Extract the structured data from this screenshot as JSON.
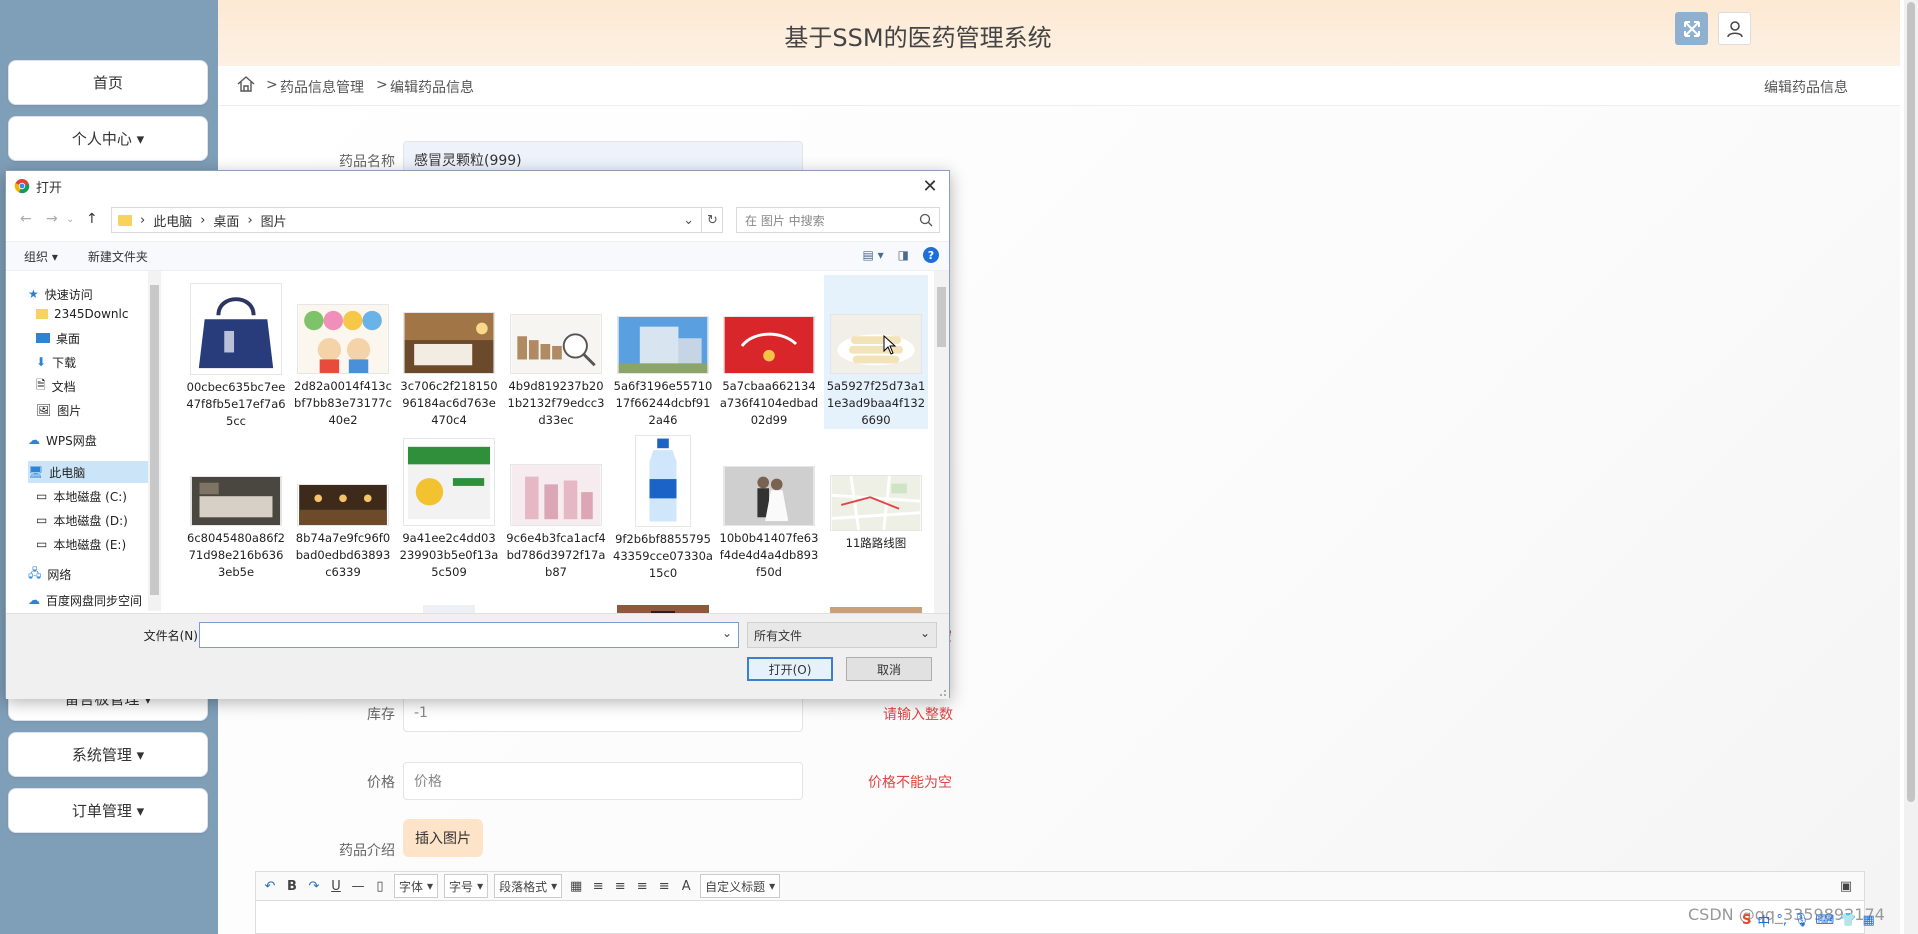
{
  "app": {
    "title": "基于SSM的医药管理系统"
  },
  "sidebar": {
    "items": [
      {
        "label": "首页"
      },
      {
        "label": "个人中心 ▾"
      },
      {
        "label": "留言板管理 ▾"
      },
      {
        "label": "系统管理 ▾"
      },
      {
        "label": "订单管理 ▾"
      }
    ]
  },
  "breadcrumb": {
    "sep1": ">",
    "item1": "药品信息管理",
    "sep2": ">",
    "item2": "编辑药品信息",
    "right": "编辑药品信息"
  },
  "form": {
    "name_label": "药品名称",
    "name_value": "感冒灵颗粒(999)",
    "stock_label": "库存",
    "stock_value": "-1",
    "stock_hint": "请输入整数",
    "price_label": "价格",
    "price_placeholder": "价格",
    "price_hint": "价格不能为空",
    "partial_hint": "空",
    "intro_label": "药品介绍",
    "insert_image": "插入图片"
  },
  "editor_toolbar": {
    "bold": "B",
    "italic": "I",
    "underline": "U",
    "font": "字体",
    "size": "字号",
    "paragraph": "段落格式",
    "font_letter": "A",
    "custom_title": "自定义标题"
  },
  "watermark": "CSDN @qq_3359892174",
  "ime": {
    "lang": "中"
  },
  "dialog": {
    "title": "打开",
    "path": [
      "此电脑",
      "桌面",
      "图片"
    ],
    "search_placeholder": "在 图片 中搜索",
    "organize": "组织 ▾",
    "new_folder": "新建文件夹",
    "nav": [
      "快速访问",
      "2345Downlc",
      "桌面",
      "下载",
      "文档",
      "图片",
      "WPS网盘",
      "此电脑",
      "本地磁盘 (C:)",
      "本地磁盘 (D:)",
      "本地磁盘 (E:)",
      "网络",
      "百度网盘同步空间"
    ],
    "files": [
      {
        "name": "00cbec635bc7ee47f8fb5e17ef7a65cc",
        "thumb": "handbag"
      },
      {
        "name": "2d82a0014f413cbf7bb83e73177c40e2",
        "thumb": "abcd-kids"
      },
      {
        "name": "3c706c2f21815096184ac6d763e470c4",
        "thumb": "hotel-room"
      },
      {
        "name": "4b9d819237b201b2132f79edcc3d33ec",
        "thumb": "coins"
      },
      {
        "name": "5a6f3196e5571017f66244dcbf912a46",
        "thumb": "building"
      },
      {
        "name": "5a7cbaa662134a736f4104edbad02d99",
        "thumb": "red-banner"
      },
      {
        "name": "5a5927f25d73a11e3ad9baa4f1326690",
        "thumb": "food-rolls"
      },
      {
        "name": "6c8045480a86f271d98e216b6363eb5e",
        "thumb": "bedroom"
      },
      {
        "name": "8b74a7e9fc96f0bad0edbd63893c6339",
        "thumb": "restaurant"
      },
      {
        "name": "9a41ee2c4dd03239903b5e0f13a5c509",
        "thumb": "medicine-box"
      },
      {
        "name": "9c6e4b3fca1acf4bd786d3972f17ab87",
        "thumb": "cosmetics"
      },
      {
        "name": "9f2b6bf885579543359cce07330a15c0",
        "thumb": "water-bottle"
      },
      {
        "name": "10b0b41407fe63f4de4d4a4db893f50d",
        "thumb": "wedding"
      },
      {
        "name": "11路路线图",
        "thumb": "map"
      }
    ],
    "filename_label": "文件名(N):",
    "filename_value": "",
    "filetype": "所有文件",
    "open": "打开(O)",
    "cancel": "取消"
  },
  "colors": {
    "sidebar_bg": "#7f9eb8",
    "header_bg": "#fde9d3",
    "hint_red": "#e04545",
    "insert_btn": "#fde3c8"
  }
}
